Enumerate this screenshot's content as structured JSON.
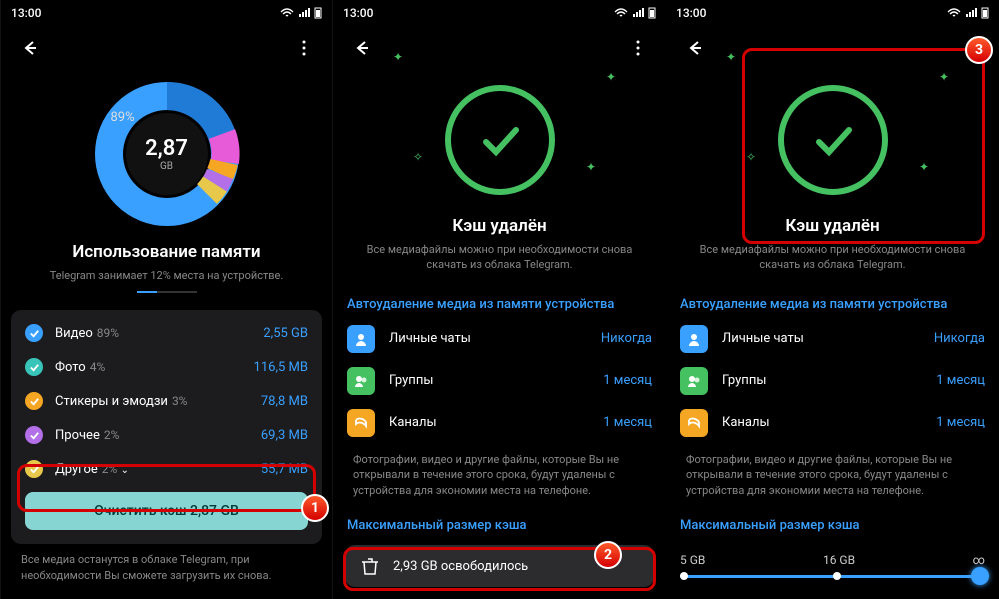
{
  "status": {
    "time": "13:00"
  },
  "panel1": {
    "chart": {
      "value": "2,87",
      "unit": "GB",
      "main_pct": "89%"
    },
    "heading": "Использование памяти",
    "subtext": "Telegram занимает 12% места на устройстве.",
    "categories": [
      {
        "label": "Видео",
        "pct": "89%",
        "size": "2,55 GB",
        "color": "#3aa0ff"
      },
      {
        "label": "Фото",
        "pct": "4%",
        "size": "116,5 MB",
        "color": "#38c4b8"
      },
      {
        "label": "Стикеры и эмодзи",
        "pct": "3%",
        "size": "78,8 MB",
        "color": "#f5a623"
      },
      {
        "label": "Прочее",
        "pct": "2%",
        "size": "69,3 MB",
        "color": "#b26fe8"
      },
      {
        "label": "Другое",
        "pct": "2%",
        "size": "55,7 MB",
        "color": "#e8c84a",
        "expandable": true
      }
    ],
    "clear_btn": "Очистить кэш  2,87 GB",
    "note": "Все медиа останутся в облаке Telegram, при необходимости Вы сможете загрузить их снова."
  },
  "cleared": {
    "heading": "Кэш удалён",
    "subtext": "Все медиафайлы можно при необходимости снова скачать из облака Telegram.",
    "auto_delete": {
      "title": "Автоудаление медиа из памяти устройства",
      "rows": [
        {
          "label": "Личные чаты",
          "value": "Никогда",
          "color": "#3aa0ff"
        },
        {
          "label": "Группы",
          "value": "1 месяц",
          "color": "#45c162"
        },
        {
          "label": "Каналы",
          "value": "1 месяц",
          "color": "#f5a623"
        }
      ],
      "note": "Фотографии, видео и другие файлы, которые Вы не открывали в течение этого срока, будут удалены с устройства для экономии места на телефоне."
    },
    "max_cache": {
      "title": "Максимальный размер кэша",
      "labels": [
        "5 GB",
        "16 GB",
        "∞"
      ]
    },
    "toast": "2,93 GB освободилось"
  },
  "chart_data": {
    "type": "pie",
    "title": "Использование памяти",
    "series": [
      {
        "name": "Видео",
        "value": 2.55,
        "unit": "GB",
        "pct": 89
      },
      {
        "name": "Фото",
        "value": 116.5,
        "unit": "MB",
        "pct": 4
      },
      {
        "name": "Стикеры и эмодзи",
        "value": 78.8,
        "unit": "MB",
        "pct": 3
      },
      {
        "name": "Прочее",
        "value": 69.3,
        "unit": "MB",
        "pct": 2
      },
      {
        "name": "Другое",
        "value": 55.7,
        "unit": "MB",
        "pct": 2
      }
    ],
    "total": {
      "value": 2.87,
      "unit": "GB"
    }
  }
}
